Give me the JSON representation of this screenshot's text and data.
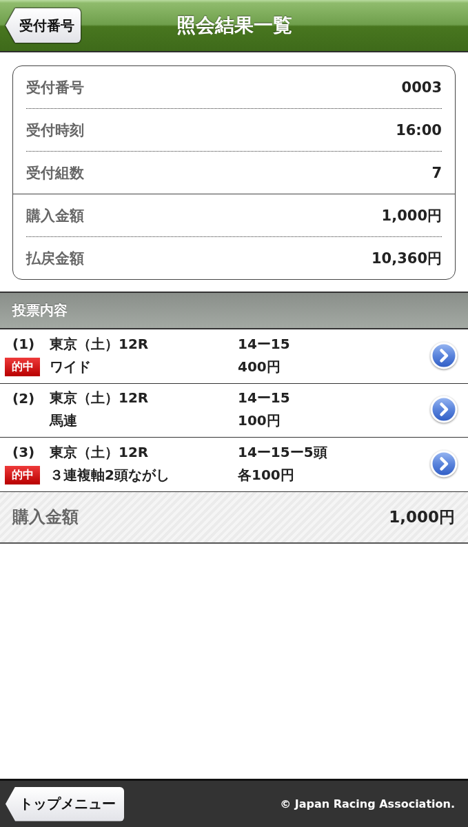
{
  "header": {
    "back_button": "受付番号",
    "title": "照会結果一覧"
  },
  "summary": {
    "groups": [
      {
        "rows": [
          {
            "label": "受付番号",
            "value": "0003"
          },
          {
            "label": "受付時刻",
            "value": "16:00"
          },
          {
            "label": "受付組数",
            "value": "7"
          }
        ]
      },
      {
        "rows": [
          {
            "label": "購入金額",
            "value": "1,000円"
          },
          {
            "label": "払戻金額",
            "value": "10,360円"
          }
        ]
      }
    ]
  },
  "section": {
    "title": "投票内容"
  },
  "bets": [
    {
      "number": "(1)",
      "race": "東京（土）12R",
      "combination": "14ー15",
      "badge": "的中",
      "bet_type": "ワイド",
      "amount": "400円"
    },
    {
      "number": "(2)",
      "race": "東京（土）12R",
      "combination": "14ー15",
      "bet_type": "馬連",
      "amount": "100円"
    },
    {
      "number": "(3)",
      "race": "東京（土）12R",
      "combination": "14ー15ー5頭",
      "badge": "的中",
      "bet_type": "３連複軸2頭ながし",
      "amount": "各100円"
    }
  ],
  "total": {
    "label": "購入金額",
    "value": "1,000円"
  },
  "footer": {
    "back_button": "トップメニュー",
    "copyright": "© Japan Racing Association."
  }
}
